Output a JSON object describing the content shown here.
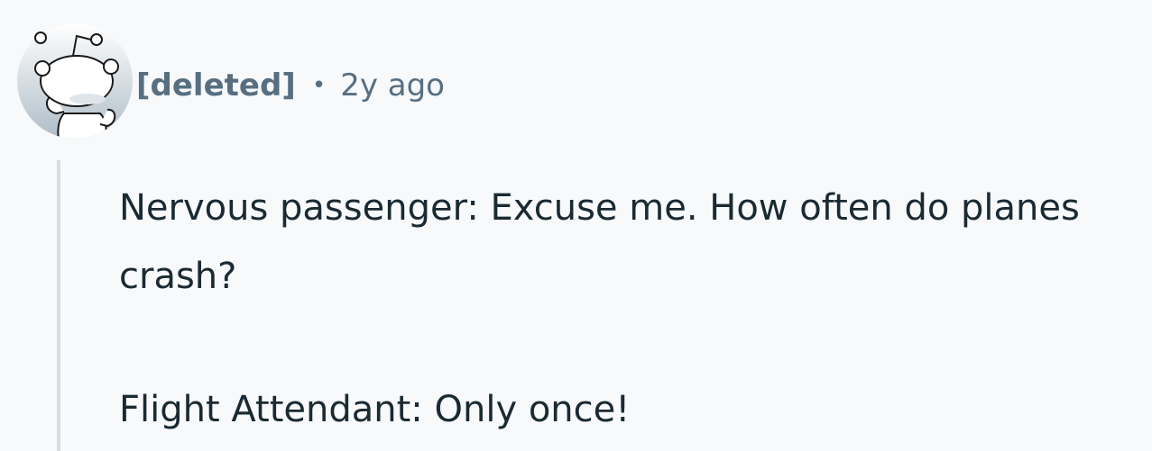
{
  "comment": {
    "author": "[deleted]",
    "separator": "•",
    "timestamp": "2y ago",
    "avatar_icon": "deleted-user-snoo-icon",
    "paragraphs": [
      "Nervous passenger: Excuse me. How often do planes crash?",
      "Flight Attendant: Only once!"
    ]
  },
  "colors": {
    "background": "#f7f9fb",
    "meta_text": "#576f80",
    "body_text": "#1a2a33",
    "thread_line": "#d6dde3"
  }
}
